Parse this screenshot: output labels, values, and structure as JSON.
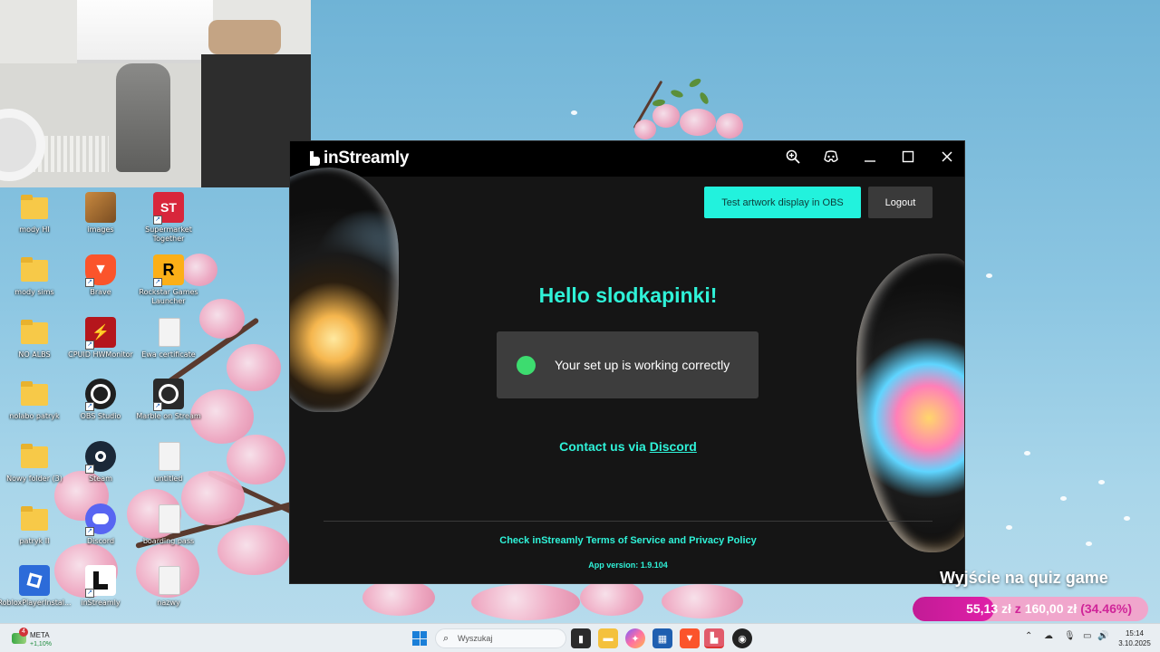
{
  "desktop": {
    "icons": [
      {
        "label": "mody HI"
      },
      {
        "label": "images"
      },
      {
        "label": "Supermarket Together"
      },
      {
        "label": "mody sims"
      },
      {
        "label": "Brave"
      },
      {
        "label": "Rockstar Games Launcher"
      },
      {
        "label": "NO ALBS"
      },
      {
        "label": "CPUID HWMonitor"
      },
      {
        "label": "Ewa certificate"
      },
      {
        "label": "nolabo patryk"
      },
      {
        "label": "OBS Studio"
      },
      {
        "label": "Marble on Stream"
      },
      {
        "label": "Nowy folder (3)"
      },
      {
        "label": "Steam"
      },
      {
        "label": "untitled"
      },
      {
        "label": "patryk II"
      },
      {
        "label": "Discord"
      },
      {
        "label": "boarding pass"
      },
      {
        "label": "RobloxPlayerInstal..."
      },
      {
        "label": "inStreamly"
      },
      {
        "label": "nazwy"
      }
    ]
  },
  "app": {
    "brand": "inStreamly",
    "titlebar": {
      "zoom_icon": "🔍",
      "discord_icon": "🎮",
      "minimize": "—",
      "maximize": "☐",
      "close": "✕"
    },
    "test_button": "Test artwork display in OBS",
    "logout_button": "Logout",
    "greeting": "Hello slodkapinki!",
    "status_text": "Your set up is working correctly",
    "contact_prefix": "Contact us via ",
    "contact_link": "Discord",
    "terms": "Check inStreamly Terms of Service and Privacy Policy",
    "version": "App version: 1.9.104",
    "accent_color": "#22f2dd",
    "status_color": "#3ddc6f"
  },
  "quiz_overlay": {
    "title": "Wyjście na quiz game",
    "current": "55,13 zł",
    "separator": "z",
    "goal": "160,00 zł",
    "percent": "(34.46%)",
    "progress_fraction": 0.3446
  },
  "taskbar": {
    "weather_badge": "4",
    "ticker_name": "META",
    "ticker_change": "+1,10%",
    "search_placeholder": "Wyszukaj",
    "time": "15:14",
    "date": "3.10.2025"
  }
}
